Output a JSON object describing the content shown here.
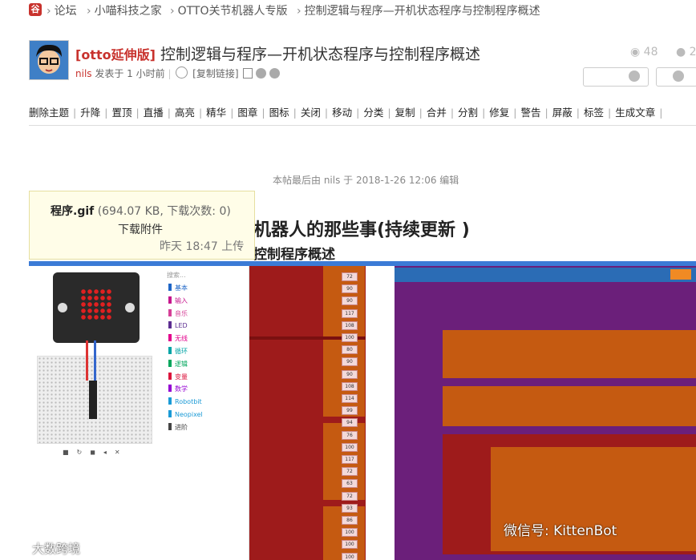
{
  "breadcrumb": {
    "logo": "谷",
    "items": [
      "论坛",
      "小喵科技之家",
      "OTTO关节机器人专版",
      "控制逻辑与程序—开机状态程序与控制程序概述"
    ]
  },
  "post": {
    "tag": "[otto延伸版]",
    "title": "控制逻辑与程序—开机状态程序与控制程序概述",
    "author": "nils",
    "posted": "发表于 1 小时前",
    "copy_link": "[复制链接]",
    "views": "48",
    "replies": "2"
  },
  "admin_actions": [
    "删除主题",
    "升降",
    "置顶",
    "直播",
    "高亮",
    "精华",
    "图章",
    "图标",
    "关闭",
    "移动",
    "分类",
    "复制",
    "合并",
    "分割",
    "修复",
    "警告",
    "屏蔽",
    "标签",
    "生成文章"
  ],
  "edited_note": "本帖最后由 nils 于 2018-1-26 12:06 编辑",
  "content": {
    "heading1": "机器人的那些事(持续更新 )",
    "heading2": "控制程序概述"
  },
  "tooltip": {
    "filename": "程序.gif",
    "info": "(694.07 KB, 下载次数: 0)",
    "download": "下载附件",
    "time": "昨天 18:47 上传"
  },
  "editor": {
    "palette": [
      "基本",
      "输入",
      "音乐",
      "LED",
      "无线",
      "循环",
      "逻辑",
      "变量",
      "数学",
      "Robotbit",
      "Neopixel",
      "进阶"
    ],
    "palette_colors": [
      "#1e66c7",
      "#c6168d",
      "#d53f97",
      "#5c2d91",
      "#e3008c",
      "#00a4a6",
      "#00a65c",
      "#dc143c",
      "#9400d3",
      "#1a9ad6",
      "#1a9ad6",
      "#444444"
    ],
    "numbers": [
      "72",
      "90",
      "90",
      "117",
      "108",
      "100",
      "80",
      "90",
      "90",
      "108",
      "114",
      "99",
      "94",
      "76",
      "100",
      "117",
      "72",
      "63",
      "72",
      "93",
      "86",
      "100",
      "100",
      "100"
    ]
  },
  "watermark": {
    "wechat": "微信号: KittenBot",
    "brand": "大数跨境"
  }
}
